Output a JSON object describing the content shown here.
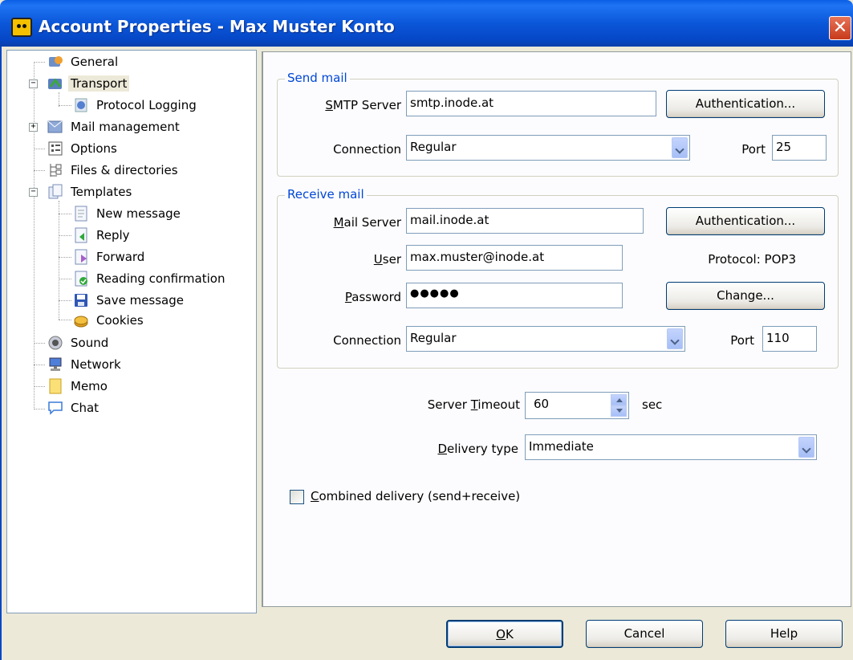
{
  "window": {
    "title": "Account Properties - Max Muster Konto",
    "close_glyph": "✕"
  },
  "tree": {
    "items": [
      {
        "label": "General",
        "icon": "general-icon"
      },
      {
        "label": "Transport",
        "icon": "transport-icon",
        "expander": "−",
        "selected": true
      },
      {
        "label": "Protocol Logging",
        "icon": "protocol-logging-icon"
      },
      {
        "label": "Mail management",
        "icon": "mail-management-icon",
        "expander": "+"
      },
      {
        "label": "Options",
        "icon": "options-icon"
      },
      {
        "label": "Files & directories",
        "icon": "files-directories-icon"
      },
      {
        "label": "Templates",
        "icon": "templates-icon",
        "expander": "−"
      },
      {
        "label": "New message",
        "icon": "new-message-icon"
      },
      {
        "label": "Reply",
        "icon": "reply-icon"
      },
      {
        "label": "Forward",
        "icon": "forward-icon"
      },
      {
        "label": "Reading confirmation",
        "icon": "reading-confirmation-icon"
      },
      {
        "label": "Save message",
        "icon": "save-message-icon"
      },
      {
        "label": "Cookies",
        "icon": "cookies-icon"
      },
      {
        "label": "Sound",
        "icon": "sound-icon"
      },
      {
        "label": "Network",
        "icon": "network-icon"
      },
      {
        "label": "Memo",
        "icon": "memo-icon"
      },
      {
        "label": "Chat",
        "icon": "chat-icon"
      }
    ]
  },
  "send_mail": {
    "legend": "Send mail",
    "smtp_label_pre": "S",
    "smtp_label_post": "MTP Server",
    "smtp_value": "smtp.inode.at",
    "auth_button": "Authentication...",
    "connection_label": "Connection",
    "connection_value": "Regular",
    "port_label": "Port",
    "port_value": "25"
  },
  "receive_mail": {
    "legend": "Receive mail",
    "server_label_pre": "M",
    "server_label_post": "ail Server",
    "server_value": "mail.inode.at",
    "auth_button": "Authentication...",
    "user_label_pre": "U",
    "user_label_post": "ser",
    "user_value": "max.muster@inode.at",
    "protocol_text": "Protocol:  POP3",
    "password_label_pre": "P",
    "password_label_post": "assword",
    "password_value": "●●●●●",
    "change_button": "Change...",
    "connection_label": "Connection",
    "connection_value": "Regular",
    "port_label": "Port",
    "port_value": "110"
  },
  "general": {
    "timeout_label_pre": "Server ",
    "timeout_label_u": "T",
    "timeout_label_post": "imeout",
    "timeout_value": "60",
    "timeout_unit": "sec",
    "delivery_label_u": "D",
    "delivery_label_post": "elivery type",
    "delivery_value": "Immediate",
    "combined_label_u": "C",
    "combined_label_post": "ombined delivery (send+receive)",
    "combined_checked": false
  },
  "footer": {
    "ok_u": "O",
    "ok_post": "K",
    "cancel": "Cancel",
    "help": "Help"
  },
  "colors": {
    "titlebar": "#0b57d9",
    "legend": "#0046d5",
    "dialog_bg": "#ece9d8"
  }
}
